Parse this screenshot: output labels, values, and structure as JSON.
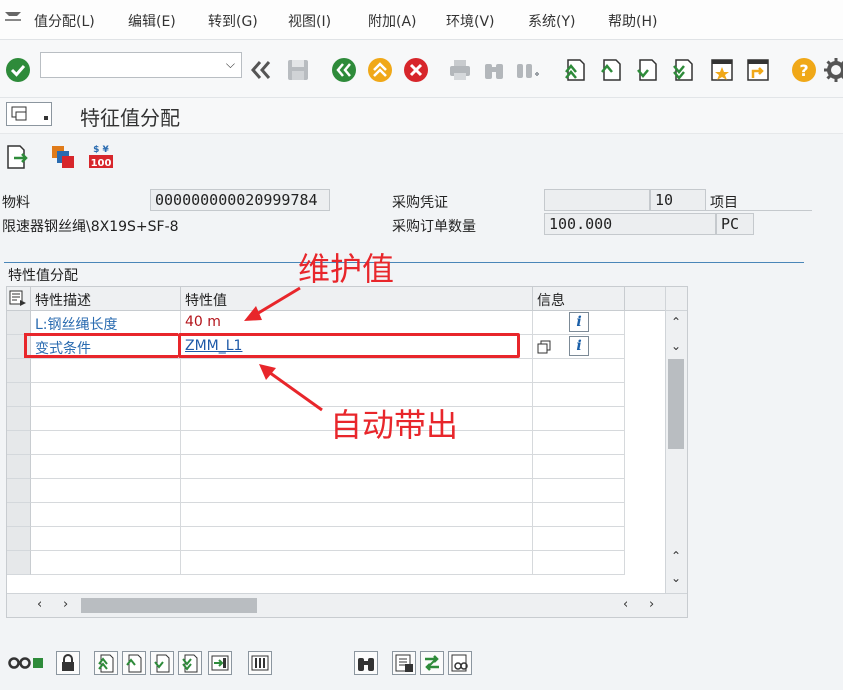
{
  "menu": {
    "items": [
      "值分配(L)",
      "编辑(E)",
      "转到(G)",
      "视图(I)",
      "附加(A)",
      "环境(V)",
      "系统(Y)",
      "帮助(H)"
    ]
  },
  "toolbar": {
    "command_value": "",
    "icons": [
      "enter-check-icon",
      "back-double-icon",
      "save-icon",
      "back-green-icon",
      "exit-up-icon",
      "cancel-icon",
      "print-icon",
      "find-icon",
      "find-next-icon",
      "first-page-icon",
      "prev-page-icon",
      "next-page-icon",
      "last-page-icon",
      "favorite-icon",
      "shortcut-icon",
      "help-icon",
      "settings-icon"
    ]
  },
  "title": {
    "text": "特征值分配"
  },
  "header": {
    "material_label": "物料",
    "material_value": "000000000020999784",
    "material_desc": "限速器钢丝绳\\8X19S+SF-8",
    "po_label": "采购凭证",
    "po_value": "",
    "item_value": "10",
    "item_label": "项目",
    "qty_label": "采购订单数量",
    "qty_value": "100.000",
    "unit_value": "PC"
  },
  "group": {
    "title": "特性值分配"
  },
  "table": {
    "columns": [
      "特性描述",
      "特性值",
      "信息"
    ],
    "rows": [
      {
        "desc": "L:钢丝绳长度",
        "value": "40 m"
      },
      {
        "desc": "变式条件",
        "value": "ZMM_L1"
      }
    ]
  },
  "annotations": {
    "maintain": "维护值",
    "auto": "自动带出"
  },
  "colors": {
    "accent_red": "#e8262b",
    "desc_blue": "#2a6bb0",
    "value_red": "#b3141b",
    "value_blue": "#1f5aa8"
  }
}
